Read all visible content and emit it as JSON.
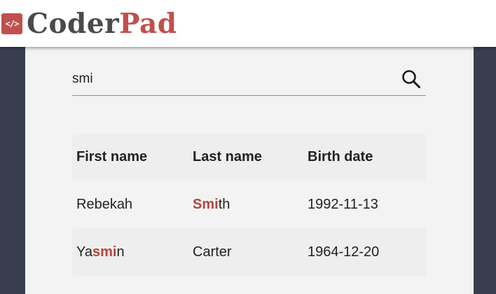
{
  "header": {
    "logo_icon_text": "</>",
    "logo_word_1": "Coder",
    "logo_word_2": "Pad"
  },
  "search": {
    "value": "smi",
    "icon": "search-icon"
  },
  "table": {
    "columns": [
      "First name",
      "Last name",
      "Birth date"
    ],
    "rows": [
      {
        "first": {
          "pre": "",
          "match": "",
          "post": "Rebekah"
        },
        "last": {
          "pre": "",
          "match": "Smi",
          "post": "th"
        },
        "birth": "1992-11-13"
      },
      {
        "first": {
          "pre": "Ya",
          "match": "smi",
          "post": "n"
        },
        "last": {
          "pre": "Carter",
          "match": "",
          "post": ""
        },
        "birth": "1964-12-20"
      }
    ]
  },
  "colors": {
    "brand_red": "#c0504d",
    "highlight": "#b6453b",
    "background_dark": "#383d4f",
    "panel": "#f3f3f3"
  }
}
